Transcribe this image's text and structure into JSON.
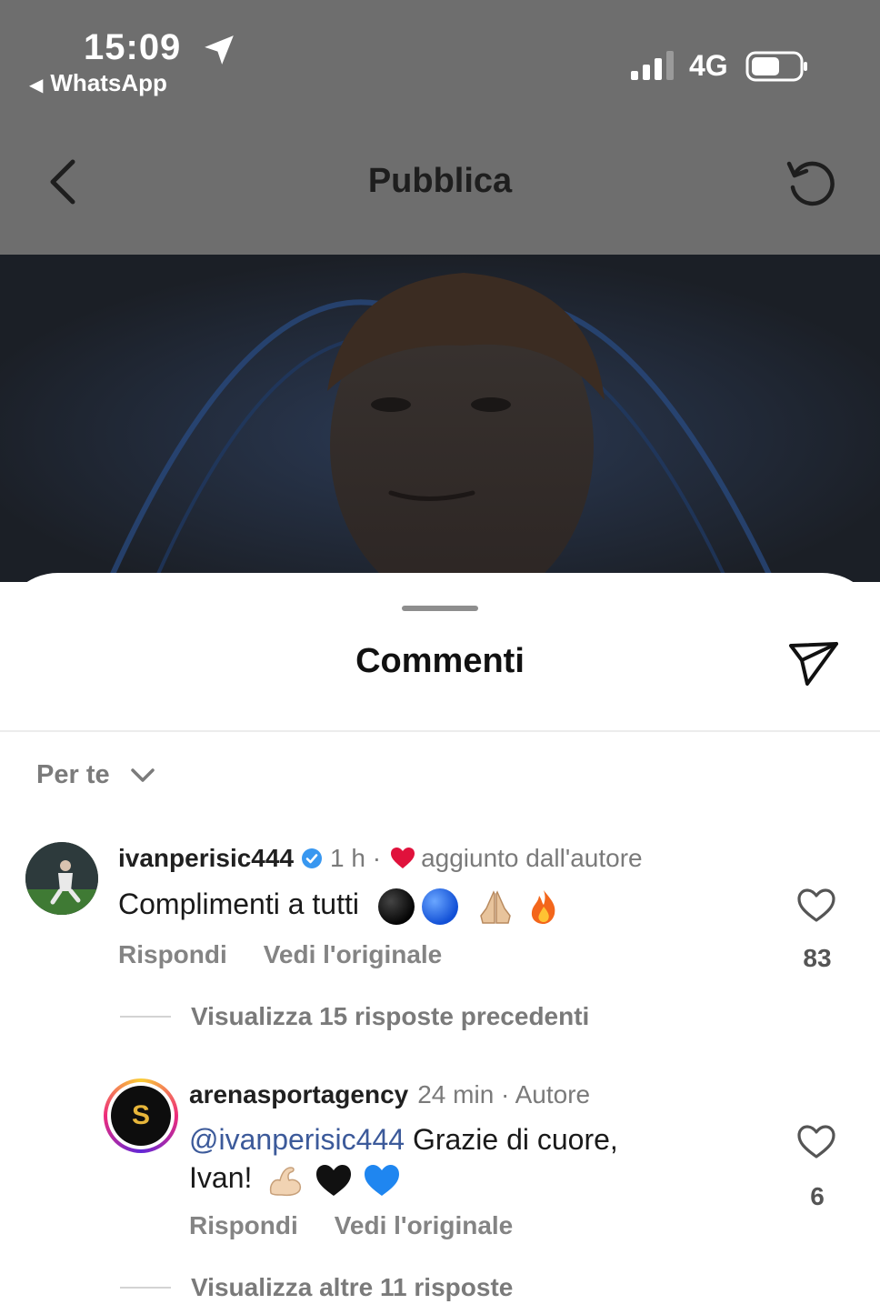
{
  "status_bar": {
    "time": "15:09",
    "back_app": "WhatsApp",
    "network": "4G"
  },
  "nav": {
    "title": "Pubblica"
  },
  "sheet": {
    "title": "Commenti",
    "filter_label": "Per te"
  },
  "comments": [
    {
      "username": "ivanperisic444",
      "verified": true,
      "time": "1 h ·",
      "author_note": "aggiunto dall'autore",
      "text": "Complimenti a tutti",
      "emojis": [
        "black-circle",
        "blue-circle",
        "folded-hands",
        "fire"
      ],
      "reply_label": "Rispondi",
      "see_original_label": "Vedi l'originale",
      "likes": "83"
    },
    {
      "username": "arenasportagency",
      "time": "24 min · Autore",
      "mention": "@ivanperisic444",
      "text": "Grazie di cuore,",
      "text_line2": "Ivan!",
      "emojis": [
        "flexed-biceps",
        "black-heart",
        "blue-heart"
      ],
      "reply_label": "Rispondi",
      "see_original_label": "Vedi l'originale",
      "likes": "6"
    }
  ],
  "view_previous_replies": "Visualizza 15 risposte precedenti",
  "view_more_replies": "Visualizza altre 11 risposte",
  "avatar_logo_text": "S",
  "colors": {
    "overlay_gray": "#6e6e6e",
    "mention_blue": "#3c5a9a",
    "heart_red": "#e0123c"
  }
}
